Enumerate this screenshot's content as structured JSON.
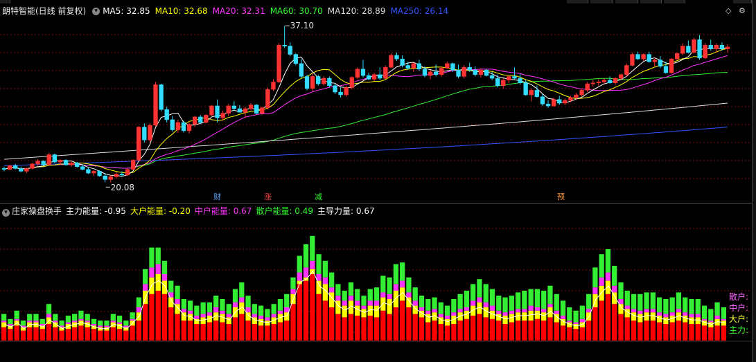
{
  "header": {
    "title": "朗特智能(日线 前复权)",
    "ma": [
      {
        "label": "MA5: 32.85",
        "color": "#ffffff"
      },
      {
        "label": "MA10: 32.68",
        "color": "#ffff00"
      },
      {
        "label": "MA20: 32.31",
        "color": "#ff33ff"
      },
      {
        "label": "MA60: 30.70",
        "color": "#33ff33"
      },
      {
        "label": "MA120: 28.89",
        "color": "#dcdcdc"
      },
      {
        "label": "MA250: 26.14",
        "color": "#3355ff"
      }
    ]
  },
  "price_annotations": {
    "high": "37.10",
    "low": "20.08"
  },
  "event_markers": [
    {
      "text": "财",
      "color": "#5fa8ff"
    },
    {
      "text": "涨",
      "color": "#ff4444"
    },
    {
      "text": "减",
      "color": "#33ff33"
    },
    {
      "text": "预",
      "color": "#ff9933"
    }
  ],
  "indicator": {
    "title": "庄家操盘换手",
    "values": [
      {
        "label": "主力能量: -0.95",
        "color": "#ffffff"
      },
      {
        "label": "大户能量: -0.20",
        "color": "#ffff00"
      },
      {
        "label": "中户能量: 0.67",
        "color": "#ff33ff"
      },
      {
        "label": "散户能量: 0.49",
        "color": "#33ff33"
      },
      {
        "label": "主导力量: 0.67",
        "color": "#ffffff"
      }
    ],
    "legend": [
      {
        "label": "散户:",
        "color": "#ff66ff"
      },
      {
        "label": "中户:",
        "color": "#ff66ff"
      },
      {
        "label": "大户:",
        "color": "#ffff33"
      },
      {
        "label": "主力:",
        "color": "#33ff33"
      }
    ]
  },
  "colors": {
    "up": "#ff3333",
    "down": "#33ddff",
    "bg": "#000000",
    "main": "#ff0000",
    "big": "#ffff00",
    "mid": "#ff33ff",
    "retail": "#33ee33"
  },
  "chart_data": {
    "type": "candlestick",
    "candles": [
      [
        21.6,
        21.8,
        21.3,
        21.5
      ],
      [
        21.5,
        22.0,
        21.4,
        21.9
      ],
      [
        21.9,
        22.1,
        21.5,
        21.6
      ],
      [
        21.6,
        21.8,
        21.2,
        21.3
      ],
      [
        21.3,
        21.7,
        21.1,
        21.6
      ],
      [
        21.6,
        22.2,
        21.5,
        22.1
      ],
      [
        22.1,
        22.6,
        21.9,
        22.4
      ],
      [
        22.4,
        22.5,
        21.9,
        22.0
      ],
      [
        22.0,
        23.3,
        21.9,
        23.1
      ],
      [
        23.1,
        23.2,
        22.2,
        22.3
      ],
      [
        22.3,
        22.6,
        22.0,
        22.5
      ],
      [
        22.5,
        22.6,
        21.9,
        22.0
      ],
      [
        22.0,
        22.4,
        21.8,
        22.2
      ],
      [
        22.2,
        22.3,
        21.7,
        21.8
      ],
      [
        21.8,
        22.0,
        21.4,
        21.5
      ],
      [
        21.5,
        21.7,
        21.0,
        21.1
      ],
      [
        21.1,
        21.4,
        20.8,
        21.3
      ],
      [
        21.3,
        21.4,
        20.7,
        20.8
      ],
      [
        20.8,
        21.1,
        20.1,
        20.4
      ],
      [
        20.4,
        20.9,
        20.1,
        20.7
      ],
      [
        20.7,
        21.2,
        20.5,
        21.0
      ],
      [
        21.0,
        21.3,
        20.7,
        20.9
      ],
      [
        20.9,
        21.6,
        20.8,
        21.5
      ],
      [
        21.5,
        22.6,
        21.4,
        22.5
      ],
      [
        22.5,
        26.2,
        22.4,
        26.1
      ],
      [
        26.1,
        26.5,
        24.4,
        24.7
      ],
      [
        24.7,
        26.5,
        24.5,
        26.3
      ],
      [
        26.3,
        31.0,
        26.2,
        30.7
      ],
      [
        30.7,
        30.8,
        27.8,
        28.0
      ],
      [
        28.0,
        28.3,
        26.6,
        26.9
      ],
      [
        26.9,
        27.3,
        25.6,
        25.8
      ],
      [
        25.8,
        26.9,
        25.5,
        26.6
      ],
      [
        26.6,
        26.8,
        25.5,
        25.7
      ],
      [
        25.7,
        26.6,
        25.4,
        26.4
      ],
      [
        26.4,
        27.3,
        26.1,
        27.2
      ],
      [
        27.2,
        27.4,
        26.4,
        26.6
      ],
      [
        26.6,
        27.5,
        26.5,
        27.4
      ],
      [
        27.4,
        28.5,
        27.3,
        28.4
      ],
      [
        28.4,
        29.1,
        26.6,
        27.1
      ],
      [
        27.1,
        27.9,
        26.8,
        27.6
      ],
      [
        27.6,
        28.6,
        27.3,
        28.4
      ],
      [
        28.4,
        28.9,
        27.9,
        28.1
      ],
      [
        28.1,
        28.5,
        27.7,
        27.7
      ],
      [
        27.7,
        28.3,
        27.1,
        28.1
      ],
      [
        28.1,
        28.7,
        27.9,
        28.5
      ],
      [
        28.5,
        28.6,
        27.5,
        27.6
      ],
      [
        27.6,
        28.3,
        27.4,
        28.2
      ],
      [
        28.2,
        30.4,
        28.0,
        30.2
      ],
      [
        30.2,
        31.3,
        30.0,
        31.0
      ],
      [
        31.0,
        35.2,
        30.9,
        35.0
      ],
      [
        35.0,
        37.1,
        34.7,
        34.9
      ],
      [
        34.9,
        35.3,
        33.8,
        34.0
      ],
      [
        34.0,
        34.1,
        32.8,
        33.0
      ],
      [
        33.0,
        33.5,
        31.4,
        31.6
      ],
      [
        31.6,
        31.8,
        30.1,
        30.3
      ],
      [
        30.3,
        31.9,
        30.0,
        31.6
      ],
      [
        31.6,
        31.8,
        30.6,
        30.8
      ],
      [
        30.8,
        31.6,
        30.6,
        31.4
      ],
      [
        31.4,
        31.6,
        30.4,
        30.6
      ],
      [
        30.6,
        30.8,
        29.7,
        29.9
      ],
      [
        29.9,
        30.4,
        29.3,
        29.6
      ],
      [
        29.6,
        30.6,
        29.4,
        30.4
      ],
      [
        30.4,
        31.6,
        30.2,
        31.5
      ],
      [
        31.5,
        32.6,
        31.3,
        32.4
      ],
      [
        32.4,
        33.4,
        31.5,
        31.7
      ],
      [
        31.7,
        32.0,
        31.2,
        31.3
      ],
      [
        31.3,
        32.0,
        31.1,
        31.8
      ],
      [
        31.8,
        32.6,
        31.2,
        31.4
      ],
      [
        31.4,
        32.8,
        31.3,
        32.6
      ],
      [
        32.6,
        34.1,
        32.5,
        33.9
      ],
      [
        33.9,
        34.2,
        33.3,
        33.5
      ],
      [
        33.5,
        33.9,
        32.6,
        32.8
      ],
      [
        32.8,
        33.2,
        32.3,
        32.5
      ],
      [
        32.5,
        33.1,
        32.1,
        33.0
      ],
      [
        33.0,
        33.4,
        32.2,
        32.4
      ],
      [
        32.4,
        32.7,
        31.5,
        31.7
      ],
      [
        31.7,
        32.3,
        31.3,
        32.1
      ],
      [
        32.1,
        32.9,
        31.6,
        31.8
      ],
      [
        31.8,
        32.7,
        31.6,
        32.5
      ],
      [
        32.5,
        33.2,
        32.4,
        33.0
      ],
      [
        33.0,
        33.1,
        32.1,
        32.3
      ],
      [
        32.3,
        32.9,
        31.4,
        31.6
      ],
      [
        31.6,
        32.8,
        31.4,
        32.6
      ],
      [
        32.6,
        33.1,
        32.1,
        32.3
      ],
      [
        32.3,
        32.7,
        31.6,
        31.8
      ],
      [
        31.8,
        32.5,
        31.5,
        32.3
      ],
      [
        32.3,
        32.4,
        31.6,
        31.7
      ],
      [
        31.7,
        32.1,
        31.2,
        31.4
      ],
      [
        31.4,
        31.8,
        30.4,
        30.6
      ],
      [
        30.6,
        31.4,
        30.3,
        31.2
      ],
      [
        31.2,
        31.7,
        30.9,
        31.6
      ],
      [
        31.6,
        32.6,
        31.3,
        31.4
      ],
      [
        31.4,
        31.9,
        30.7,
        30.9
      ],
      [
        30.9,
        31.2,
        29.5,
        29.6
      ],
      [
        29.6,
        30.3,
        28.9,
        30.1
      ],
      [
        30.1,
        30.6,
        29.3,
        29.4
      ],
      [
        29.4,
        29.7,
        28.4,
        28.6
      ],
      [
        28.6,
        29.0,
        28.2,
        28.4
      ],
      [
        28.4,
        29.3,
        28.3,
        29.1
      ],
      [
        29.1,
        29.5,
        28.5,
        28.7
      ],
      [
        28.7,
        29.2,
        28.5,
        29.0
      ],
      [
        29.0,
        29.5,
        28.8,
        29.3
      ],
      [
        29.3,
        29.8,
        29.1,
        29.6
      ],
      [
        29.6,
        30.3,
        29.4,
        30.1
      ],
      [
        30.1,
        31.0,
        29.9,
        30.8
      ],
      [
        30.8,
        31.2,
        30.5,
        30.9
      ],
      [
        30.9,
        31.3,
        30.6,
        31.0
      ],
      [
        31.0,
        31.4,
        30.8,
        31.2
      ],
      [
        31.2,
        31.6,
        30.8,
        30.9
      ],
      [
        30.9,
        31.5,
        30.7,
        31.4
      ],
      [
        31.4,
        31.9,
        31.2,
        31.8
      ],
      [
        31.8,
        33.0,
        31.6,
        32.8
      ],
      [
        32.8,
        34.2,
        32.7,
        34.0
      ],
      [
        34.0,
        34.3,
        33.4,
        33.5
      ],
      [
        33.5,
        34.1,
        33.3,
        34.0
      ],
      [
        34.0,
        34.3,
        33.1,
        33.2
      ],
      [
        33.2,
        33.6,
        32.7,
        33.4
      ],
      [
        33.4,
        33.8,
        32.5,
        32.7
      ],
      [
        32.7,
        33.2,
        31.9,
        32.0
      ],
      [
        32.0,
        33.6,
        31.9,
        33.5
      ],
      [
        33.5,
        34.2,
        33.4,
        34.1
      ],
      [
        34.1,
        35.2,
        33.9,
        34.9
      ],
      [
        34.9,
        35.5,
        34.1,
        34.2
      ],
      [
        34.2,
        35.8,
        34.1,
        35.6
      ],
      [
        35.6,
        36.1,
        33.4,
        33.6
      ],
      [
        33.6,
        35.2,
        33.5,
        35.0
      ],
      [
        35.0,
        35.6,
        34.4,
        34.6
      ],
      [
        34.6,
        35.2,
        34.2,
        35.0
      ],
      [
        35.0,
        35.3,
        34.4,
        34.6
      ],
      [
        34.6,
        35.1,
        34.2,
        34.8
      ]
    ],
    "ma_last": {
      "MA5": 32.85,
      "MA10": 32.68,
      "MA20": 32.31,
      "MA60": 30.7,
      "MA120": 28.89,
      "MA250": 26.14
    },
    "indicator_bars": {
      "series": [
        "主力",
        "大户",
        "中户",
        "散户"
      ],
      "main": [
        8,
        7,
        9,
        6,
        8,
        8,
        7,
        10,
        8,
        6,
        7,
        8,
        9,
        8,
        7,
        6,
        6,
        8,
        7,
        6,
        9,
        12,
        22,
        28,
        30,
        28,
        20,
        16,
        12,
        12,
        10,
        10,
        11,
        12,
        11,
        10,
        14,
        16,
        12,
        10,
        9,
        9,
        10,
        11,
        12,
        22,
        34,
        36,
        40,
        28,
        24,
        20,
        16,
        14,
        16,
        15,
        14,
        15,
        14,
        18,
        16,
        20,
        24,
        20,
        16,
        14,
        11,
        12,
        10,
        9,
        10,
        12,
        13,
        15,
        16,
        14,
        13,
        12,
        10,
        11,
        12,
        12,
        12,
        13,
        12,
        14,
        11,
        9,
        8,
        7,
        8,
        12,
        20,
        24,
        28,
        22,
        16,
        14,
        12,
        11,
        12,
        12,
        11,
        10,
        11,
        12,
        11,
        10,
        10,
        9,
        8,
        9,
        9
      ],
      "big": [
        3,
        2,
        3,
        2,
        3,
        3,
        2,
        4,
        3,
        2,
        3,
        3,
        3,
        3,
        2,
        2,
        2,
        3,
        3,
        2,
        3,
        5,
        8,
        10,
        10,
        8,
        6,
        6,
        5,
        4,
        3,
        4,
        4,
        5,
        5,
        4,
        6,
        7,
        5,
        4,
        4,
        3,
        4,
        5,
        5,
        6,
        2,
        2,
        3,
        8,
        10,
        9,
        8,
        7,
        8,
        6,
        5,
        6,
        7,
        8,
        9,
        10,
        8,
        6,
        5,
        4,
        5,
        5,
        4,
        4,
        5,
        5,
        5,
        6,
        7,
        6,
        5,
        4,
        5,
        5,
        5,
        5,
        6,
        5,
        5,
        6,
        5,
        4,
        3,
        3,
        3,
        5,
        8,
        9,
        8,
        7,
        6,
        5,
        5,
        5,
        5,
        5,
        4,
        4,
        4,
        5,
        4,
        4,
        4,
        3,
        3,
        4,
        3
      ],
      "mid": [
        1,
        1,
        1,
        1,
        1,
        1,
        1,
        2,
        1,
        1,
        1,
        1,
        1,
        1,
        1,
        1,
        1,
        1,
        1,
        1,
        1,
        3,
        4,
        6,
        6,
        4,
        3,
        3,
        2,
        2,
        2,
        2,
        2,
        3,
        2,
        2,
        3,
        3,
        3,
        2,
        2,
        2,
        2,
        2,
        3,
        3,
        5,
        6,
        5,
        4,
        4,
        3,
        3,
        3,
        3,
        3,
        2,
        3,
        3,
        3,
        3,
        4,
        4,
        3,
        3,
        2,
        2,
        2,
        2,
        2,
        2,
        2,
        2,
        3,
        3,
        3,
        3,
        2,
        2,
        2,
        2,
        2,
        3,
        2,
        2,
        2,
        2,
        2,
        1,
        1,
        2,
        2,
        4,
        5,
        5,
        4,
        3,
        2,
        2,
        2,
        2,
        2,
        2,
        2,
        2,
        2,
        2,
        2,
        2,
        1,
        1,
        2,
        1
      ],
      "retail": [
        4,
        3,
        5,
        3,
        4,
        4,
        3,
        6,
        4,
        3,
        4,
        4,
        5,
        4,
        3,
        3,
        3,
        4,
        4,
        3,
        4,
        6,
        9,
        12,
        10,
        8,
        7,
        8,
        6,
        6,
        6,
        7,
        6,
        7,
        7,
        6,
        8,
        9,
        7,
        6,
        6,
        5,
        6,
        7,
        8,
        7,
        10,
        14,
        15,
        12,
        10,
        9,
        7,
        6,
        8,
        7,
        6,
        7,
        8,
        10,
        10,
        12,
        11,
        9,
        8,
        7,
        7,
        7,
        7,
        6,
        8,
        9,
        10,
        10,
        11,
        11,
        10,
        9,
        9,
        9,
        10,
        11,
        10,
        11,
        11,
        11,
        10,
        9,
        8,
        7,
        8,
        9,
        12,
        14,
        14,
        12,
        10,
        9,
        9,
        10,
        10,
        10,
        9,
        9,
        9,
        10,
        9,
        9,
        9,
        8,
        7,
        8,
        7
      ]
    }
  }
}
